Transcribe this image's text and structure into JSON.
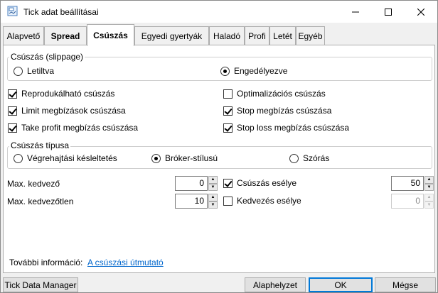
{
  "window": {
    "title": "Tick adat beállításai"
  },
  "tabs": [
    {
      "label": "Alapvető"
    },
    {
      "label": "Spread"
    },
    {
      "label": "Csúszás"
    },
    {
      "label": "Egyedi gyertyák"
    },
    {
      "label": "Haladó"
    },
    {
      "label": "Profi"
    },
    {
      "label": "Letét"
    },
    {
      "label": "Egyéb"
    }
  ],
  "slippage_group": {
    "title": "Csúszás (slippage)",
    "disabled_label": "Letiltva",
    "enabled_label": "Engedélyezve",
    "selected": "enabled"
  },
  "checkboxes": {
    "reproducible": {
      "label": "Reprodukálható csúszás",
      "checked": true
    },
    "limit_orders": {
      "label": "Limit megbízások csúszása",
      "checked": true
    },
    "take_profit": {
      "label": "Take profit megbízás csúszása",
      "checked": true
    },
    "optimization": {
      "label": "Optimalizációs csúszás",
      "checked": false
    },
    "stop_order": {
      "label": "Stop megbízás csúszása",
      "checked": true
    },
    "stop_loss": {
      "label": "Stop loss megbízás csúszása",
      "checked": true
    }
  },
  "type_group": {
    "title": "Csúszás típusa",
    "execution_delay_label": "Végrehajtási késleltetés",
    "broker_style_label": "Bróker-stílusú",
    "deviation_label": "Szórás",
    "selected": "broker_style"
  },
  "fields": {
    "max_favorable_label": "Max. kedvező",
    "max_favorable_value": "0",
    "max_unfavorable_label": "Max. kedvezőtlen",
    "max_unfavorable_value": "10",
    "slippage_chance_label": "Csúszás esélye",
    "slippage_chance_checked": true,
    "slippage_chance_value": "50",
    "favorable_chance_label": "Kedvezés esélye",
    "favorable_chance_checked": false,
    "favorable_chance_value": "0"
  },
  "more_info": {
    "label": "További információ:",
    "link": "A csúszási útmutató"
  },
  "buttons": {
    "tick_data_manager": "Tick Data Manager",
    "reset": "Alaphelyzet",
    "ok": "OK",
    "cancel": "Mégse"
  },
  "icons": {
    "app": "settings-app-icon",
    "minimize": "minimize-icon",
    "maximize": "maximize-icon",
    "close": "close-icon"
  }
}
